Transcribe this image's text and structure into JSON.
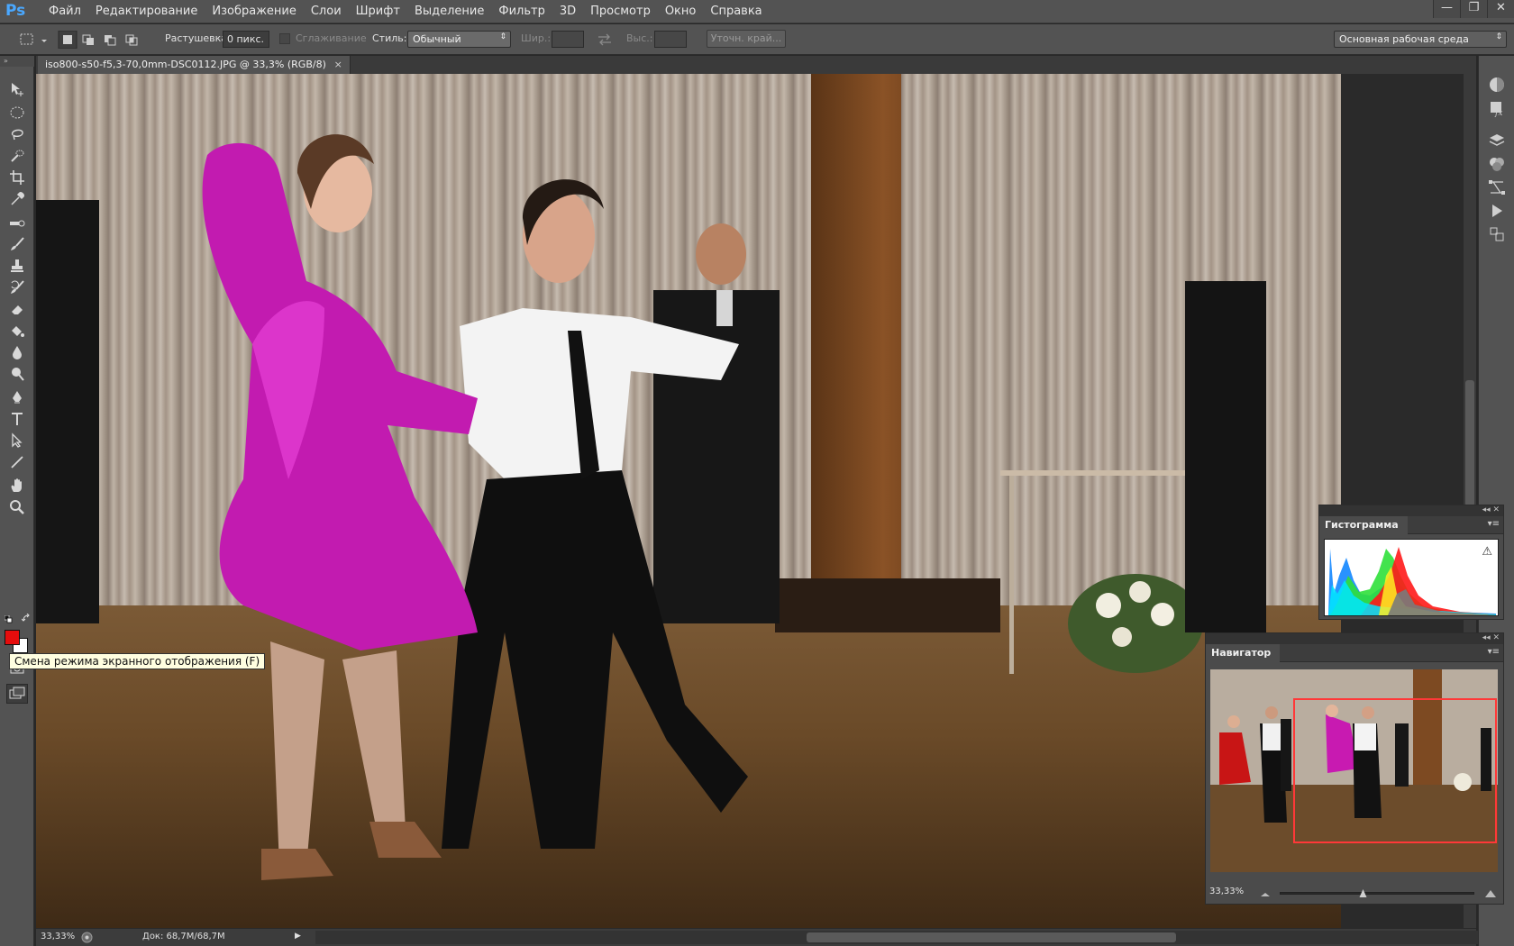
{
  "app": {
    "logo": "Ps",
    "menu": [
      "Файл",
      "Редактирование",
      "Изображение",
      "Слои",
      "Шрифт",
      "Выделение",
      "Фильтр",
      "3D",
      "Просмотр",
      "Окно",
      "Справка"
    ],
    "window_controls": {
      "minimize": "—",
      "restore": "❐",
      "close": "✕"
    }
  },
  "options_bar": {
    "feather_label": "Растушевка:",
    "feather_value": "0 пикс.",
    "antialias_label": "Сглаживание",
    "style_label": "Стиль:",
    "style_value": "Обычный",
    "width_label": "Шир.:",
    "height_label": "Выс.:",
    "refine_edge_label": "Уточн. край...",
    "workspace_value": "Основная рабочая среда"
  },
  "document": {
    "tab_title": "iso800-s50-f5,3-70,0mm-DSC0112.JPG @ 33,3% (RGB/8)",
    "tab_close": "×"
  },
  "status_bar": {
    "zoom": "33,33%",
    "doc_info": "Док: 68,7M/68,7M",
    "arrow": "▶"
  },
  "panels": {
    "histogram": {
      "title": "Гистограмма",
      "warning": "⚠"
    },
    "navigator": {
      "title": "Навигатор",
      "zoom": "33,33%"
    }
  },
  "tooltip": {
    "text": "Смена режима экранного отображения (F)"
  },
  "colors": {
    "foreground": "#e50c0c",
    "background": "#ffffff",
    "panel": "#535353",
    "accent": "#4aa8ff"
  },
  "tools": [
    "move-icon",
    "marquee-icon",
    "lasso-icon",
    "quick-select-icon",
    "crop-icon",
    "eyedropper-icon",
    "healing-icon",
    "brush-icon",
    "stamp-icon",
    "history-brush-icon",
    "eraser-icon",
    "bucket-icon",
    "blur-icon",
    "dodge-icon",
    "pen-icon",
    "type-icon",
    "path-select-icon",
    "line-icon",
    "hand-icon",
    "zoom-icon",
    "quick-mask-icon",
    "screen-mode-icon"
  ]
}
